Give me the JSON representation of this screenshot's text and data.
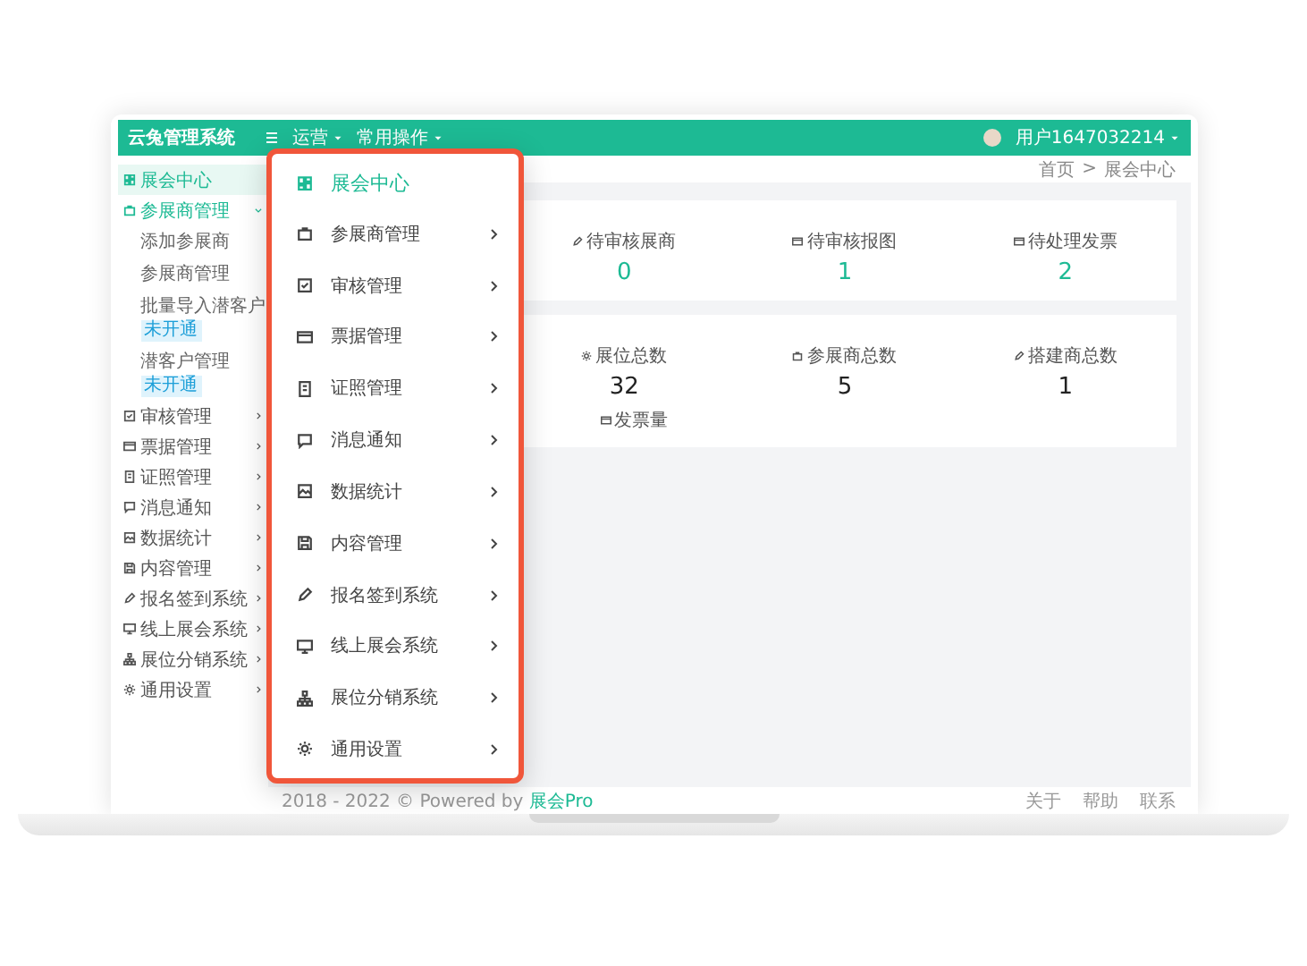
{
  "header": {
    "title": "云兔管理系统",
    "menus": [
      {
        "label": "运营"
      },
      {
        "label": "常用操作"
      }
    ],
    "user": "用户1647032214"
  },
  "sidebar": {
    "items": [
      {
        "label": "展会中心",
        "selected": true
      },
      {
        "label": "参展商管理",
        "selected": false,
        "expanded": true,
        "children": [
          {
            "label": "添加参展商"
          },
          {
            "label": "参展商管理"
          },
          {
            "label": "批量导入潜客户",
            "badge": "未开通"
          },
          {
            "label": "潜客户管理",
            "badge": "未开通"
          }
        ]
      },
      {
        "label": "审核管理",
        "selected": false,
        "expanded": false
      },
      {
        "label": "票据管理",
        "selected": false,
        "expanded": false
      },
      {
        "label": "证照管理",
        "selected": false,
        "expanded": false
      },
      {
        "label": "消息通知",
        "selected": false,
        "expanded": false
      },
      {
        "label": "数据统计",
        "selected": false,
        "expanded": false
      },
      {
        "label": "内容管理",
        "selected": false,
        "expanded": false
      },
      {
        "label": "报名签到系统",
        "selected": false,
        "expanded": false
      },
      {
        "label": "线上展会系统",
        "selected": false,
        "expanded": false
      },
      {
        "label": "展位分销系统",
        "selected": false,
        "expanded": false
      },
      {
        "label": "通用设置",
        "selected": false,
        "expanded": false
      }
    ]
  },
  "breadcrumb": {
    "items": [
      "首页",
      "展会中心"
    ],
    "separator": ">"
  },
  "cards": [
    {
      "kind": "pending",
      "stats": [
        {
          "label": "待审核展商",
          "value": "0"
        },
        {
          "label": "待审核报图",
          "value": "1"
        },
        {
          "label": "待处理发票",
          "value": "2"
        }
      ]
    },
    {
      "kind": "total",
      "stats": [
        {
          "label": "展位总数",
          "value": "32"
        },
        {
          "label": "参展商总数",
          "value": "5"
        },
        {
          "label": "搭建商总数",
          "value": "1"
        }
      ],
      "extra_label": "发票量"
    }
  ],
  "footer": {
    "copyright": "2018 - 2022 © Powered by",
    "brand": "展会Pro",
    "links": [
      "关于",
      "帮助",
      "联系"
    ]
  },
  "overlay_menu": {
    "items": [
      {
        "label": "展会中心",
        "selected": true,
        "expandable": false
      },
      {
        "label": "参展商管理",
        "selected": false,
        "expandable": true
      },
      {
        "label": "审核管理",
        "selected": false,
        "expandable": true
      },
      {
        "label": "票据管理",
        "selected": false,
        "expandable": true
      },
      {
        "label": "证照管理",
        "selected": false,
        "expandable": true
      },
      {
        "label": "消息通知",
        "selected": false,
        "expandable": true
      },
      {
        "label": "数据统计",
        "selected": false,
        "expandable": true
      },
      {
        "label": "内容管理",
        "selected": false,
        "expandable": true
      },
      {
        "label": "报名签到系统",
        "selected": false,
        "expandable": true
      },
      {
        "label": "线上展会系统",
        "selected": false,
        "expandable": true
      },
      {
        "label": "展位分销系统",
        "selected": false,
        "expandable": true
      },
      {
        "label": "通用设置",
        "selected": false,
        "expandable": true
      }
    ]
  }
}
